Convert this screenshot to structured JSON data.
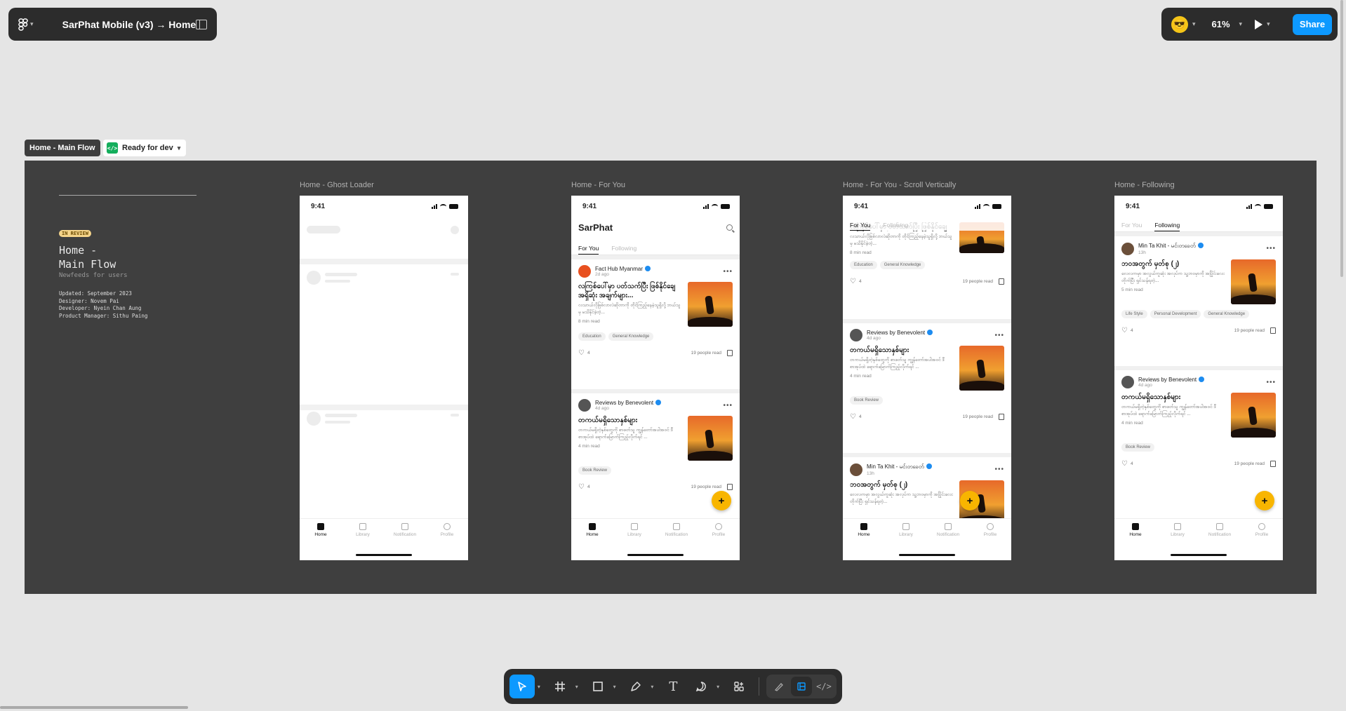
{
  "topbar": {
    "file_title": "SarPhat Mobile (v3) → Home",
    "zoom": "61%",
    "share_label": "Share",
    "avatar_emoji": "😎"
  },
  "section": {
    "name": "Home - Main Flow",
    "status": "Ready for dev",
    "status_icon": "</>"
  },
  "cover": {
    "badge": "IN REVIEW",
    "title": "Home -\nMain Flow",
    "subtitle": "Newfeeds for users",
    "meta": [
      "Updated: September 2023",
      "Designer: Novem Pai",
      "Developer: Nyein Chan Aung",
      "Product Manager: Sithu Paing"
    ]
  },
  "frames": [
    {
      "label": "Home - Ghost Loader"
    },
    {
      "label": "Home - For You"
    },
    {
      "label": "Home - For You - Scroll Vertically"
    },
    {
      "label": "Home - Following"
    }
  ],
  "phone": {
    "time": "9:41",
    "app_name": "SarPhat",
    "tab_for_you": "For You",
    "tab_following": "Following",
    "nav": [
      "Home",
      "Library",
      "Notification",
      "Profile"
    ],
    "fab": "+"
  },
  "posts": {
    "fact_hub": {
      "author": "Fact Hub Myanmar",
      "time": "2d ago",
      "title": "လကြစ်ပေါ်မှာ ပတ်သက်ပြီး ဖြစ်နိုင်ချေအရှိဆုံး အချက်များ...",
      "excerpt": "လသာယ်လိုဖြစ်လာလဲဆိုတာကို တိုင်ကြည့်နေမဲ့သူရှိလို့ ဘယ်သူမှ မသိနိုင်ခဲ့တဲ့...",
      "read": "8 min read",
      "chips": [
        "Education",
        "General Knowledge"
      ],
      "likes": "4",
      "readers": "19 people read"
    },
    "reviews": {
      "author": "Reviews by Benevolent",
      "time": "4d ago",
      "title": "တကယ်မရှိသောနှစ်များ",
      "excerpt": "တကယ်မရှိတဲ့နှစ်တွေကို စာဖတ်သူ ကျွန်တော်အပါအဝင် ဒီစာအုပ်ထဲ ရောက်မြောက်ကြည့်လိုက်ရင် ...",
      "read": "4 min read",
      "chips": [
        "Book Review"
      ],
      "likes": "4",
      "readers": "19 people read"
    },
    "min_ta_khit": {
      "author": "Min Ta Khit - မင်းတခေတ်",
      "time": "13h",
      "title": "ဘဝအတွက် မှတ်စု (၂)",
      "excerpt": "လေလကမှာ အလွယ်ကူဆုံး အလုပ်က သူ့ဘဝမှာကို အပြိုင်းလေးတိုက်ပြီး ရှင်သန်ရတဲ့...",
      "read": "5 min read",
      "chips": [
        "Life Style",
        "Personal Development",
        "General Knowledge"
      ],
      "likes": "4",
      "readers": "19 people read"
    }
  },
  "toolbar": {
    "tools": [
      "move-tool",
      "frame-tool",
      "shape-tool",
      "pen-tool",
      "text-tool",
      "comment-tool",
      "actions-tool"
    ],
    "text_tool_glyph": "T",
    "dev_code_glyph": "</>"
  }
}
